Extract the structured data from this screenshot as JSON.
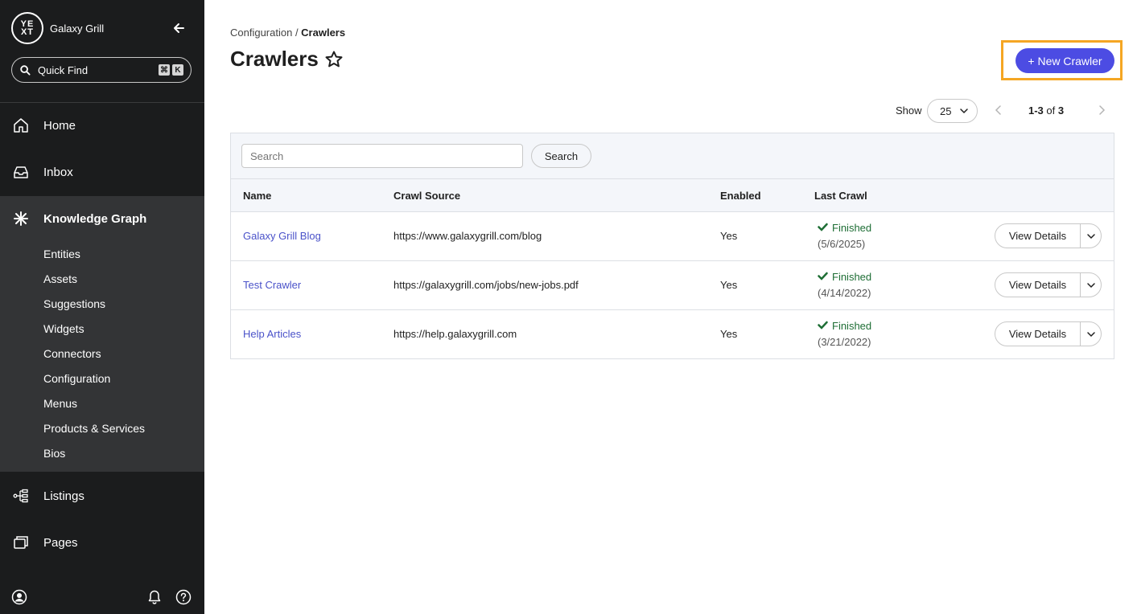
{
  "sidebar": {
    "brand_logo": "YEXT",
    "brand_name": "Galaxy Grill",
    "quickfind_label": "Quick Find",
    "kbd": [
      "⌘",
      "K"
    ],
    "nav": {
      "home": "Home",
      "inbox": "Inbox",
      "knowledge_graph": "Knowledge Graph",
      "listings": "Listings",
      "pages": "Pages"
    },
    "kg_items": [
      "Entities",
      "Assets",
      "Suggestions",
      "Widgets",
      "Connectors",
      "Configuration",
      "Menus",
      "Products & Services",
      "Bios"
    ]
  },
  "header": {
    "breadcrumb_parent": "Configuration",
    "breadcrumb_sep": " / ",
    "breadcrumb_current": "Crawlers",
    "title": "Crawlers",
    "new_button": "+ New Crawler"
  },
  "pager": {
    "show_label": "Show",
    "page_size": "25",
    "range": "1-3",
    "of": "of",
    "total": "3"
  },
  "table": {
    "search_placeholder": "Search",
    "search_button": "Search",
    "columns": [
      "Name",
      "Crawl Source",
      "Enabled",
      "Last Crawl"
    ],
    "rows": [
      {
        "name": "Galaxy Grill Blog",
        "source": "https://www.galaxygrill.com/blog",
        "enabled": "Yes",
        "status": "Finished",
        "date": "(5/6/2025)",
        "action": "View Details"
      },
      {
        "name": "Test Crawler",
        "source": "https://galaxygrill.com/jobs/new-jobs.pdf",
        "enabled": "Yes",
        "status": "Finished",
        "date": "(4/14/2022)",
        "action": "View Details"
      },
      {
        "name": "Help Articles",
        "source": "https://help.galaxygrill.com",
        "enabled": "Yes",
        "status": "Finished",
        "date": "(3/21/2022)",
        "action": "View Details"
      }
    ]
  },
  "colors": {
    "sidebar_bg": "#1b1c1d",
    "kg_section_bg": "#333436",
    "accent": "#4c4ce3",
    "highlight": "#f5a623",
    "link": "#4a52c9",
    "success": "#1e6e35"
  },
  "icons": [
    "yext-logo",
    "back-arrow-icon",
    "search-icon",
    "home-icon",
    "inbox-icon",
    "knowledge-graph-icon",
    "listings-icon",
    "pages-icon",
    "user-icon",
    "bell-icon",
    "help-icon",
    "star-icon",
    "chevron-down-icon",
    "chevron-left-icon",
    "chevron-right-icon",
    "check-icon"
  ]
}
